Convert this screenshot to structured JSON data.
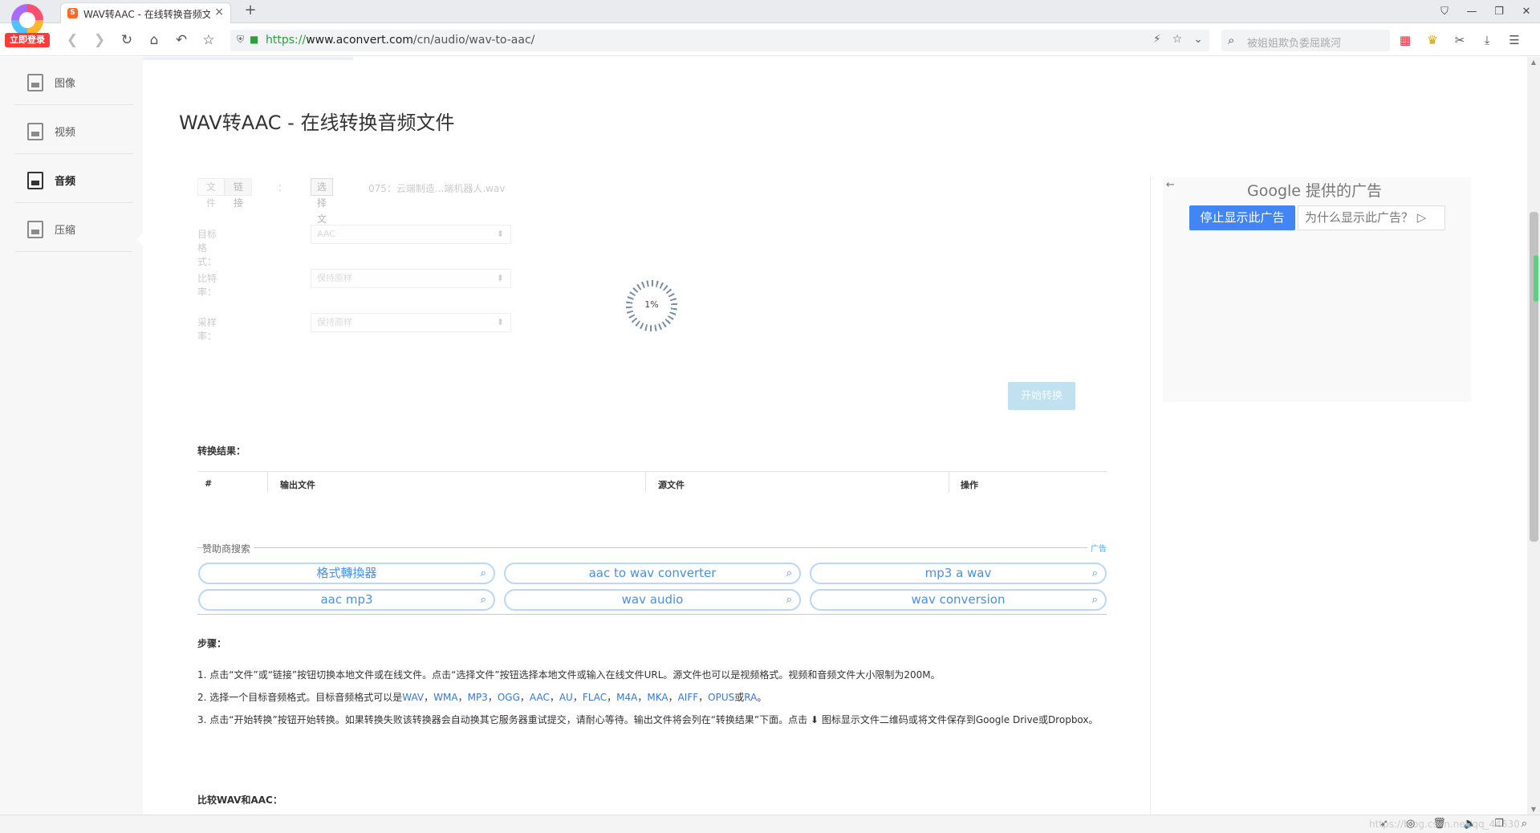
{
  "browser": {
    "login_badge": "立即登录",
    "tab_title": "WAV转AAC - 在线转换音频文",
    "tab_close": "×",
    "new_tab": "+",
    "url_proto": "https://",
    "url_host": "www.aconvert.com",
    "url_path": "/cn/audio/wav-to-aac/",
    "search_placeholder": "被姐姐欺负委屈跳河",
    "window_controls": [
      "⛉",
      "—",
      "❐",
      "✕"
    ]
  },
  "sidebar": {
    "items": [
      {
        "label": "图像",
        "icon": "image-file-icon"
      },
      {
        "label": "视频",
        "icon": "video-file-icon"
      },
      {
        "label": "音频",
        "icon": "audio-file-icon"
      },
      {
        "label": "压缩",
        "icon": "archive-file-icon"
      }
    ],
    "active": "音频"
  },
  "main": {
    "title": "WAV转AAC - 在线转换音频文件",
    "form": {
      "source_tabs": [
        "文件",
        "链接"
      ],
      "colon": "：",
      "choose_file": "选择文件",
      "file_name": "075：云端制造...端机器人.wav",
      "target_format_label": "目标格式：",
      "target_format_value": "AAC",
      "bitrate_label": "比特率：",
      "bitrate_value": "保持原样",
      "samplerate_label": "采样率：",
      "samplerate_value": "保持原样",
      "start_button": "开始转换"
    },
    "progress": {
      "percent": 1,
      "text": "1%"
    },
    "results": {
      "label": "转换结果：",
      "columns": [
        "#",
        "输出文件",
        "源文件",
        "操作"
      ]
    },
    "sponsor": {
      "caption": "赞助商搜索",
      "ad_label": "广告",
      "pills": [
        "格式轉換器",
        "aac to wav converter",
        "mp3 a wav",
        "aac mp3",
        "wav audio",
        "wav conversion"
      ]
    },
    "steps": {
      "label": "步骤：",
      "step1": "1. 点击“文件”或“链接”按钮切换本地文件或在线文件。点击“选择文件”按钮选择本地文件或输入在线文件URL。源文件也可以是视频格式。视频和音频文件大小限制为200M。",
      "step2_prefix": "2. 选择一个目标音频格式。目标音频格式可以是",
      "step2_formats": [
        "WAV",
        "WMA",
        "MP3",
        "OGG",
        "AAC",
        "AU",
        "FLAC",
        "M4A",
        "MKA",
        "AIFF",
        "OPUS"
      ],
      "step2_sep": "，",
      "step2_or": "或",
      "step2_last": "RA",
      "step2_end": "。",
      "step3": "3. 点击“开始转换”按钮开始转换。如果转换失败该转换器会自动换其它服务器重试提交，请耐心等待。输出文件将会列在“转换结果”下面。点击 ⬇ 图标显示文件二维码或将文件保存到Google Drive或Dropbox。"
    },
    "compare_label": "比较WAV和AAC："
  },
  "ad": {
    "back": "←",
    "google": "Google",
    "provided": " 提供的广告",
    "stop": "停止显示此广告",
    "why": "为什么显示此广告？ ▷"
  },
  "status": {
    "watermark": "https://blog.csdn.net/qq_44630"
  },
  "colors": {
    "accent_blue": "#4285f4",
    "link_blue": "#3a78c9",
    "secure_green": "#2e9e3e",
    "login_red": "#ff3b3b"
  }
}
